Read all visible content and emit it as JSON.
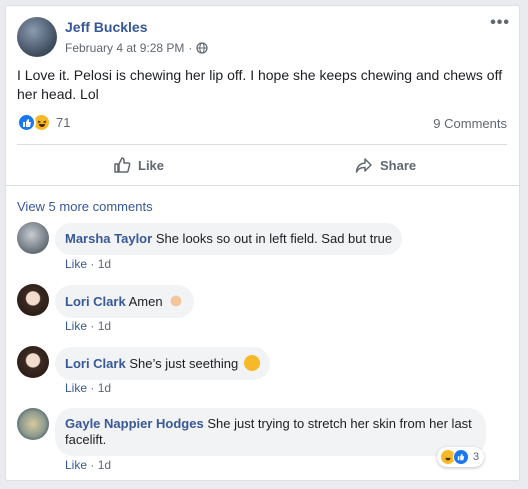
{
  "post": {
    "author": "Jeff Buckles",
    "timestamp": "February 4 at 9:28 PM",
    "separator": "·",
    "privacy_icon": "globe-icon",
    "more_label": "•••",
    "text": "I Love it. Pelosi is chewing her lip off. I hope she keeps chewing and chews off her head. Lol",
    "reaction_count": "71",
    "reaction_types": [
      "like",
      "haha"
    ],
    "comments_count": "9 Comments"
  },
  "actions": {
    "like": "Like",
    "share": "Share"
  },
  "comments_section": {
    "view_more": "View 5 more comments",
    "comments": [
      {
        "name": "Marsha Taylor",
        "text": "She looks so out in left field. Sad but true",
        "like": "Like",
        "sep": "·",
        "time": "1d"
      },
      {
        "name": "Lori Clark",
        "text": "Amen",
        "emoji": "folded-hands",
        "like": "Like",
        "sep": "·",
        "time": "1d"
      },
      {
        "name": "Lori Clark",
        "text": "She’s just seething",
        "emoji": "face-with-steam",
        "like": "Like",
        "sep": "·",
        "time": "1d"
      },
      {
        "name": "Gayle Nappier Hodges",
        "text": "She just trying to stretch her skin from her last facelift.",
        "like": "Like",
        "sep": "·",
        "time": "1d",
        "reaction_count": "3",
        "reaction_types": [
          "haha",
          "like"
        ]
      }
    ]
  },
  "colors": {
    "link": "#365899",
    "like_blue": "#1877f2",
    "haha_yellow": "#f7b928",
    "bubble_bg": "#f2f3f5"
  }
}
